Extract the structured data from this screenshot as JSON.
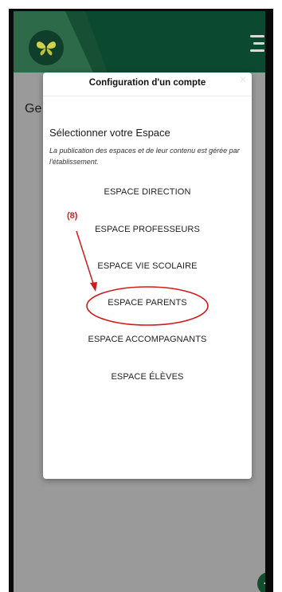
{
  "header": {
    "logo_icon": "butterfly-icon",
    "menu_icon": "menu-icon"
  },
  "page": {
    "title_partial": "Ge"
  },
  "modal": {
    "title": "Configuration d'un compte",
    "close_icon": "close-icon",
    "heading": "Sélectionner votre Espace",
    "note": "La publication des espaces et de leur contenu est gérée par l'établissement.",
    "options": [
      "ESPACE DIRECTION",
      "ESPACE PROFESSEURS",
      "ESPACE VIE SCOLAIRE",
      "ESPACE PARENTS",
      "ESPACE ACCOMPAGNANTS",
      "ESPACE ÉLÈVES"
    ]
  },
  "annotation": {
    "label": "(8)",
    "color": "#d11a1a"
  },
  "fab": {
    "icon": "plus-icon",
    "symbol": "+"
  },
  "colors": {
    "appbar": "#0b4a30",
    "accent_light": "#2f6b4b",
    "overlay": "#9a9a9a"
  }
}
